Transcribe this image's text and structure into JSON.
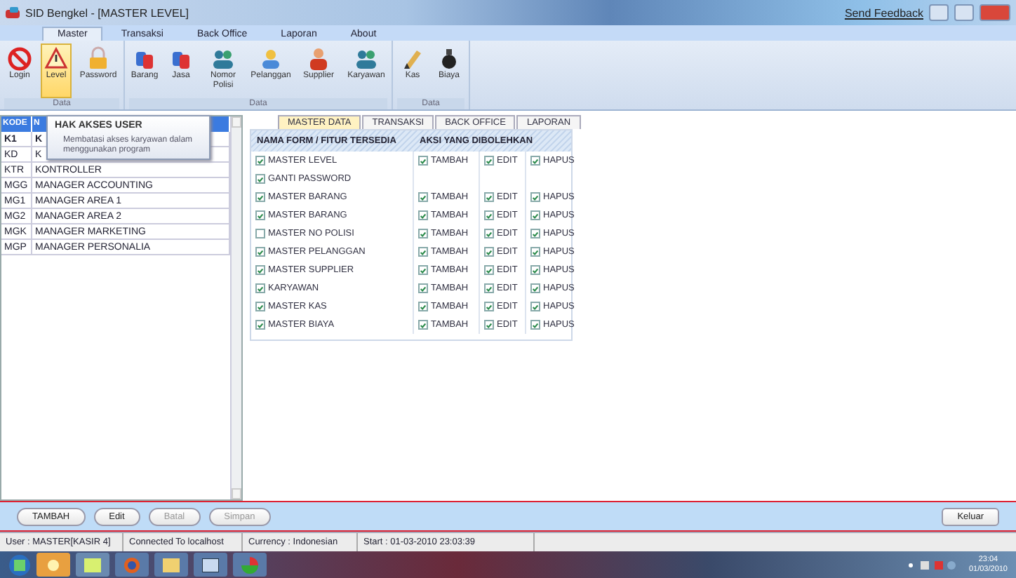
{
  "window": {
    "title": "SID Bengkel - [MASTER LEVEL]",
    "feedback": "Send Feedback"
  },
  "menu_tabs": [
    {
      "label": "Master",
      "selected": true
    },
    {
      "label": "Transaksi",
      "selected": false
    },
    {
      "label": "Back Office",
      "selected": false
    },
    {
      "label": "Laporan",
      "selected": false
    },
    {
      "label": "About",
      "selected": false
    }
  ],
  "ribbon_groups": [
    {
      "label": "Data",
      "items": [
        {
          "label": "Login",
          "selected": false
        },
        {
          "label": "Level",
          "selected": true
        },
        {
          "label": "Password",
          "selected": false
        }
      ]
    },
    {
      "label": "Data",
      "items": [
        {
          "label": "Barang",
          "selected": false
        },
        {
          "label": "Jasa",
          "selected": false
        },
        {
          "label": "Nomor Polisi",
          "selected": false
        },
        {
          "label": "Pelanggan",
          "selected": false
        },
        {
          "label": "Supplier",
          "selected": false
        },
        {
          "label": "Karyawan",
          "selected": false
        }
      ]
    },
    {
      "label": "Data",
      "items": [
        {
          "label": "Kas",
          "selected": false
        },
        {
          "label": "Biaya",
          "selected": false
        }
      ]
    }
  ],
  "level_list": {
    "columns": [
      "KODE",
      "N"
    ],
    "rows": [
      [
        "K1",
        "K"
      ],
      [
        "KD",
        "K"
      ],
      [
        "KTR",
        "KONTROLLER"
      ],
      [
        "MGG",
        "MANAGER ACCOUNTING"
      ],
      [
        "MG1",
        "MANAGER AREA 1"
      ],
      [
        "MG2",
        "MANAGER AREA 2"
      ],
      [
        "MGK",
        "MANAGER MARKETING"
      ],
      [
        "MGP",
        "MANAGER PERSONALIA"
      ]
    ]
  },
  "tooltip": {
    "title": "HAK AKSES USER",
    "text": "Membatasi akses karyawan dalam menggunakan program"
  },
  "panel_tabs": [
    {
      "label": "MASTER DATA",
      "selected": true
    },
    {
      "label": "TRANSAKSI",
      "selected": false
    },
    {
      "label": "BACK OFFICE",
      "selected": false
    },
    {
      "label": "LAPORAN",
      "selected": false
    }
  ],
  "permissions": {
    "columns": [
      "NAMA FORM / FITUR TERSEDIA",
      "AKSI YANG DIBOLEHKAN"
    ],
    "rows": [
      {
        "name": "MASTER LEVEL",
        "checked": true,
        "actions": [
          {
            "label": "TAMBAH",
            "checked": true
          },
          {
            "label": "EDIT",
            "checked": true
          },
          {
            "label": "HAPUS",
            "checked": true
          }
        ]
      },
      {
        "name": "GANTI PASSWORD",
        "checked": true,
        "actions": []
      },
      {
        "name": "MASTER BARANG",
        "checked": true,
        "actions": [
          {
            "label": "TAMBAH",
            "checked": true
          },
          {
            "label": "EDIT",
            "checked": true
          },
          {
            "label": "HAPUS",
            "checked": true
          }
        ]
      },
      {
        "name": "MASTER BARANG",
        "checked": true,
        "actions": [
          {
            "label": "TAMBAH",
            "checked": true
          },
          {
            "label": "EDIT",
            "checked": true
          },
          {
            "label": "HAPUS",
            "checked": true
          }
        ]
      },
      {
        "name": "MASTER NO POLISI",
        "checked": false,
        "actions": [
          {
            "label": "TAMBAH",
            "checked": true
          },
          {
            "label": "EDIT",
            "checked": true
          },
          {
            "label": "HAPUS",
            "checked": true
          }
        ]
      },
      {
        "name": "MASTER PELANGGAN",
        "checked": true,
        "actions": [
          {
            "label": "TAMBAH",
            "checked": true
          },
          {
            "label": "EDIT",
            "checked": true
          },
          {
            "label": "HAPUS",
            "checked": true
          }
        ]
      },
      {
        "name": "MASTER SUPPLIER",
        "checked": true,
        "actions": [
          {
            "label": "TAMBAH",
            "checked": true
          },
          {
            "label": "EDIT",
            "checked": true
          },
          {
            "label": "HAPUS",
            "checked": true
          }
        ]
      },
      {
        "name": "KARYAWAN",
        "checked": true,
        "actions": [
          {
            "label": "TAMBAH",
            "checked": true
          },
          {
            "label": "EDIT",
            "checked": true
          },
          {
            "label": "HAPUS",
            "checked": true
          }
        ]
      },
      {
        "name": "MASTER KAS",
        "checked": true,
        "actions": [
          {
            "label": "TAMBAH",
            "checked": true
          },
          {
            "label": "EDIT",
            "checked": true
          },
          {
            "label": "HAPUS",
            "checked": true
          }
        ]
      },
      {
        "name": "MASTER BIAYA",
        "checked": true,
        "actions": [
          {
            "label": "TAMBAH",
            "checked": true
          },
          {
            "label": "EDIT",
            "checked": true
          },
          {
            "label": "HAPUS",
            "checked": true
          }
        ]
      }
    ]
  },
  "buttons": [
    {
      "label": "TAMBAH",
      "disabled": false
    },
    {
      "label": "Edit",
      "disabled": false
    },
    {
      "label": "Batal",
      "disabled": true
    },
    {
      "label": "Simpan",
      "disabled": true
    }
  ],
  "exit_button": "Keluar",
  "status_bar": [
    "User : MASTER[KASIR 4]",
    "Connected To localhost",
    "Currency : Indonesian",
    "Start : 01-03-2010 23:03:39"
  ],
  "taskbar": {
    "time": "23:04",
    "date": "01/03/2010"
  }
}
